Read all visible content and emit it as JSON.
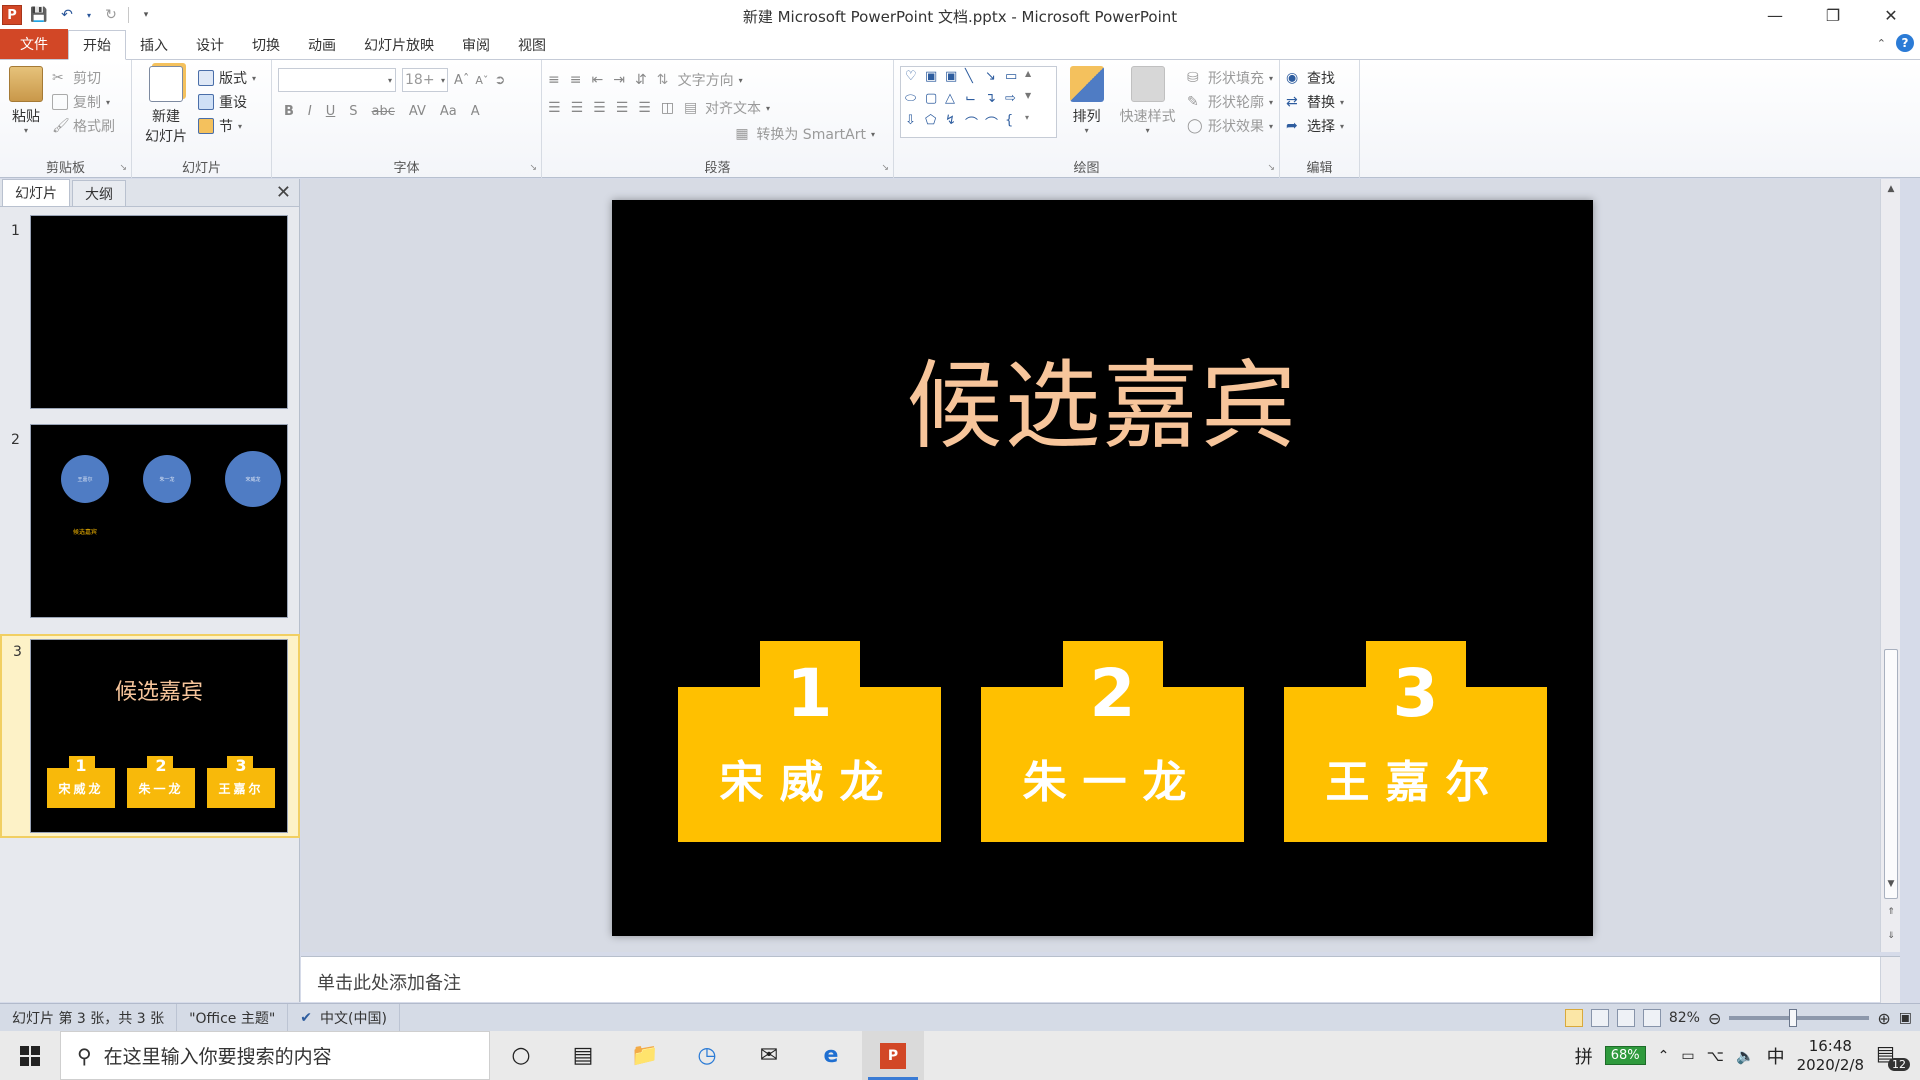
{
  "window": {
    "title": "新建 Microsoft PowerPoint 文档.pptx - Microsoft PowerPoint",
    "app_icon_letter": "P"
  },
  "tabs": [
    {
      "label": "文件",
      "kind": "file"
    },
    {
      "label": "开始",
      "kind": "active"
    },
    {
      "label": "插入"
    },
    {
      "label": "设计"
    },
    {
      "label": "切换"
    },
    {
      "label": "动画"
    },
    {
      "label": "幻灯片放映"
    },
    {
      "label": "审阅"
    },
    {
      "label": "视图"
    }
  ],
  "ribbon": {
    "clipboard": {
      "label": "剪贴板",
      "paste": "粘贴",
      "cut": "剪切",
      "copy": "复制",
      "format_painter": "格式刷"
    },
    "slides": {
      "label": "幻灯片",
      "new_slide_line1": "新建",
      "new_slide_line2": "幻灯片",
      "layout": "版式",
      "reset": "重设",
      "section": "节"
    },
    "font": {
      "label": "字体",
      "font_name": "",
      "font_size": "18+"
    },
    "paragraph": {
      "label": "段落",
      "text_direction": "文字方向",
      "align_text": "对齐文本",
      "smartart": "转换为 SmartArt"
    },
    "drawing": {
      "label": "绘图",
      "arrange": "排列",
      "quick_styles": "快速样式",
      "shape_fill": "形状填充",
      "shape_outline": "形状轮廓",
      "shape_effects": "形状效果"
    },
    "editing": {
      "label": "编辑",
      "find": "查找",
      "replace": "替换",
      "select": "选择"
    }
  },
  "left_pane": {
    "tab_slides": "幻灯片",
    "tab_outline": "大纲",
    "thumbnails": [
      {
        "num": "1"
      },
      {
        "num": "2",
        "circles": [
          "王嘉尔",
          "朱一龙",
          "宋威龙"
        ],
        "caption": "候选嘉宾"
      },
      {
        "num": "3",
        "title": "候选嘉宾",
        "podiums": [
          {
            "num": "1",
            "name": "宋威龙"
          },
          {
            "num": "2",
            "name": "朱一龙"
          },
          {
            "num": "3",
            "name": "王嘉尔"
          }
        ]
      }
    ],
    "selected_slide": 3
  },
  "slide": {
    "title": "候选嘉宾",
    "title_color": "#f7c59b",
    "podium_color": "#ffc000",
    "podiums": [
      {
        "num": "1",
        "name": "宋威龙"
      },
      {
        "num": "2",
        "name": "朱一龙"
      },
      {
        "num": "3",
        "name": "王嘉尔"
      }
    ]
  },
  "notes": {
    "placeholder": "单击此处添加备注"
  },
  "statusbar": {
    "slide_info": "幻灯片 第 3 张，共 3 张",
    "theme": "\"Office 主题\"",
    "language": "中文(中国)",
    "zoom": "82%"
  },
  "taskbar": {
    "search_placeholder": "在这里输入你要搜索的内容",
    "ime_mode": "拼",
    "battery": "68%",
    "ime_lang": "中",
    "time": "16:48",
    "date": "2020/2/8",
    "notifications": "12"
  }
}
